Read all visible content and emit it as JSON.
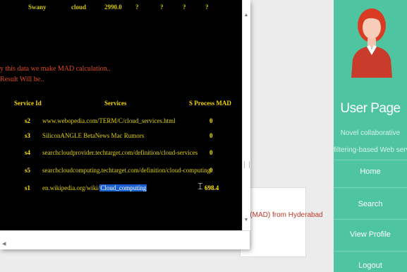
{
  "background": {
    "panel_text": "n (MAD) from Hyderabad"
  },
  "sidebar": {
    "title": "User Page",
    "subtitle_line1": "Novel collaborative",
    "subtitle_line2": "filtering-based Web serv",
    "nav": [
      "Home",
      "Search",
      "View Profile",
      "Logout"
    ],
    "colors": {
      "bg": "#4ec4a0",
      "avatar_hair": "#d93b23",
      "avatar_shirt": "#c93b2a"
    }
  },
  "console": {
    "top_row": [
      "Swany",
      "cloud",
      "2990.0",
      "?",
      "?",
      "?",
      "?"
    ],
    "message_line1": "y this data we make MAD calculation..",
    "message_line2": "Result Will be..",
    "headers": {
      "id": "Service Id",
      "services": "Services",
      "mad": "S Process MAD"
    },
    "rows": [
      {
        "id": "s2",
        "url": "www.webopedia.com/TERM/C/cloud_services.html",
        "url_suffix": "",
        "mad": "0"
      },
      {
        "id": "s3",
        "url": "SiliconANGLE BetaNews Mac Rumors",
        "url_suffix": "",
        "mad": "0"
      },
      {
        "id": "s4",
        "url": "searchcloudprovider.techtarget.com/definition/cloud-services",
        "url_suffix": "",
        "mad": "0"
      },
      {
        "id": "s5",
        "url": "searchcloudcomputing.techtarget.com/definition/cloud-computing",
        "url_suffix": "",
        "mad": "0"
      },
      {
        "id": "s1",
        "url": "en.wikipedia.org/wiki/",
        "url_suffix": "Cloud_computing",
        "mad": "698.4"
      }
    ],
    "colors": {
      "bg": "#000000",
      "text": "#e2d200",
      "message": "#e0481c",
      "selection": "#1a5fd1"
    }
  }
}
